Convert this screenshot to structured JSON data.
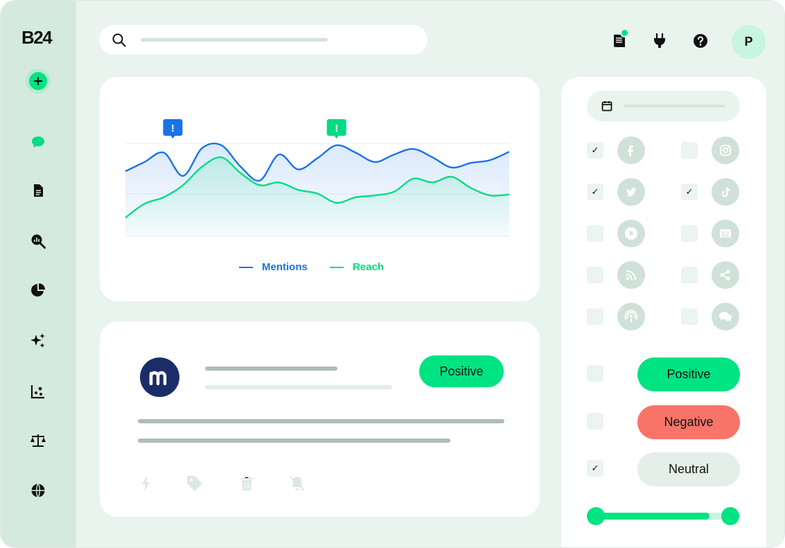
{
  "brand": {
    "logo": "B24"
  },
  "header": {
    "avatar_initial": "P"
  },
  "chart_data": {
    "type": "line",
    "x": [
      0,
      1,
      2,
      3,
      4,
      5,
      6,
      7,
      8,
      9,
      10,
      11,
      12,
      13,
      14,
      15,
      16,
      17,
      18,
      19,
      20
    ],
    "series": [
      {
        "name": "Mentions",
        "color": "#1a73e8",
        "values": [
          70,
          80,
          90,
          65,
          95,
          98,
          75,
          60,
          88,
          72,
          84,
          98,
          90,
          80,
          88,
          94,
          85,
          74,
          79,
          82,
          91
        ]
      },
      {
        "name": "Reach",
        "color": "#00dc82",
        "values": [
          20,
          35,
          42,
          55,
          75,
          85,
          68,
          55,
          58,
          50,
          46,
          36,
          42,
          44,
          48,
          62,
          58,
          64,
          52,
          44,
          45
        ]
      }
    ],
    "alerts": [
      {
        "at_index": 2,
        "color": "#1a73e8",
        "label": "!"
      },
      {
        "at_index": 11,
        "color": "#00dc82",
        "label": "!"
      }
    ],
    "legend": "bottom-center",
    "grid": true
  },
  "post": {
    "sentiment_label": "Positive",
    "logo_letter": "m"
  },
  "filters": {
    "sources": [
      {
        "name": "facebook-icon",
        "checked": true
      },
      {
        "name": "instagram-icon",
        "checked": false
      },
      {
        "name": "twitter-icon",
        "checked": true
      },
      {
        "name": "tiktok-icon",
        "checked": true
      },
      {
        "name": "video-icon",
        "checked": false
      },
      {
        "name": "news-icon",
        "checked": false
      },
      {
        "name": "rss-icon",
        "checked": false
      },
      {
        "name": "share-icon",
        "checked": false
      },
      {
        "name": "podcast-icon",
        "checked": false
      },
      {
        "name": "forum-icon",
        "checked": false
      }
    ],
    "sentiments": [
      {
        "label": "Positive",
        "checked": false,
        "color": "#00e383"
      },
      {
        "label": "Negative",
        "checked": false,
        "color": "#f87468"
      },
      {
        "label": "Neutral",
        "checked": true,
        "color": "#e4efe9"
      }
    ],
    "check_mark": "✓",
    "range": {
      "min": 0,
      "max": 1,
      "low": 0,
      "high": 0.8
    }
  },
  "colors": {
    "accent": "#00e383",
    "mentions": "#1a73e8",
    "negative": "#f87468"
  }
}
